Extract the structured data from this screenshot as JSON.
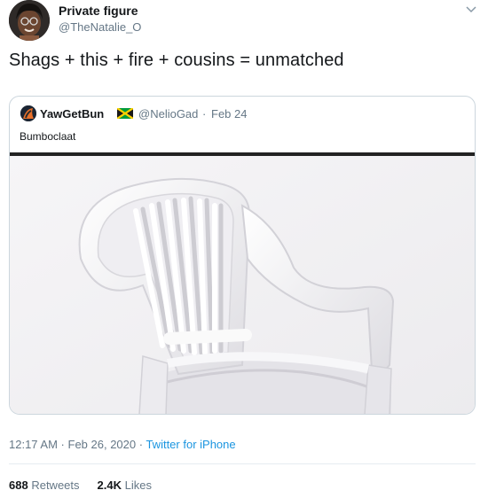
{
  "author": {
    "name": "Private figure",
    "handle": "@TheNatalie_O",
    "avatar_icon": "profile-avatar"
  },
  "tweet_text": "Shags + this + fire + cousins = unmatched",
  "quoted_tweet": {
    "name": "YawGetBun",
    "flag_icon": "jamaica-flag",
    "handle": "@NelioGad",
    "separator": "·",
    "date": "Feb 24",
    "text": "Bumboclaat",
    "media_icon": "white-plastic-chair-image"
  },
  "meta": {
    "time": "12:17 AM",
    "separator1": " · ",
    "date": "Feb 26, 2020",
    "separator2": " · ",
    "source": "Twitter for iPhone"
  },
  "stats": {
    "retweets_count": "688",
    "retweets_label": "Retweets",
    "likes_count": "2.4K",
    "likes_label": "Likes"
  },
  "colors": {
    "text": "#14171a",
    "secondary": "#657786",
    "link": "#1b95e0",
    "border": "#ccd6dd"
  }
}
